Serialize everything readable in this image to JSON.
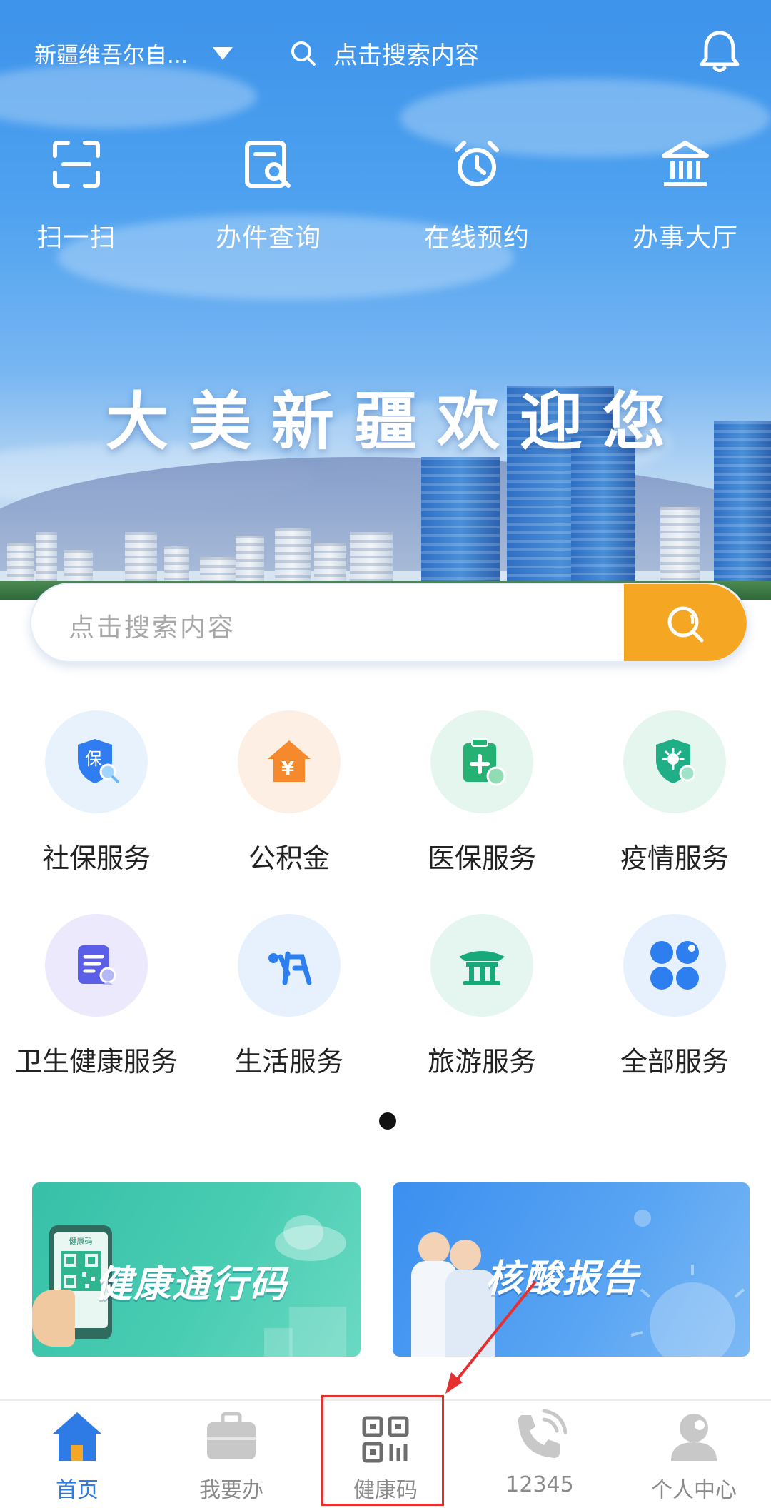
{
  "header": {
    "region": "新疆维吾尔自...",
    "search_placeholder": "点击搜索内容"
  },
  "quick_actions": [
    {
      "label": "扫一扫",
      "icon": "scan-icon"
    },
    {
      "label": "办件查询",
      "icon": "document-search-icon"
    },
    {
      "label": "在线预约",
      "icon": "alarm-clock-icon"
    },
    {
      "label": "办事大厅",
      "icon": "government-hall-icon"
    }
  ],
  "hero": {
    "welcome_text": "大美新疆欢迎您"
  },
  "main_search": {
    "placeholder": "点击搜索内容"
  },
  "services": [
    {
      "label": "社保服务",
      "icon": "social-security-shield-icon"
    },
    {
      "label": "公积金",
      "icon": "housing-fund-house-icon"
    },
    {
      "label": "医保服务",
      "icon": "medical-insurance-icon"
    },
    {
      "label": "疫情服务",
      "icon": "epidemic-shield-icon"
    },
    {
      "label": "卫生健康服务",
      "icon": "health-document-icon"
    },
    {
      "label": "生活服务",
      "icon": "life-service-icon"
    },
    {
      "label": "旅游服务",
      "icon": "pavilion-icon"
    },
    {
      "label": "全部服务",
      "icon": "grid-all-icon"
    }
  ],
  "pager": {
    "current_page": 1,
    "total_pages": 1
  },
  "banners": [
    {
      "title": "健康通行码",
      "mini_label": "健康码",
      "icon": "phone-qr-icon"
    },
    {
      "title": "核酸报告",
      "icon": "doctors-virus-icon"
    }
  ],
  "tabbar": [
    {
      "label": "首页",
      "icon": "home-icon",
      "active": true
    },
    {
      "label": "我要办",
      "icon": "briefcase-icon",
      "active": false
    },
    {
      "label": "健康码",
      "icon": "qr-code-icon",
      "active": false
    },
    {
      "label": "12345",
      "icon": "phone-icon",
      "active": false
    },
    {
      "label": "个人中心",
      "icon": "user-icon",
      "active": false
    }
  ],
  "colors": {
    "accent_blue": "#2e7be6",
    "search_button": "#f5a623",
    "annotation_red": "#e53030"
  }
}
